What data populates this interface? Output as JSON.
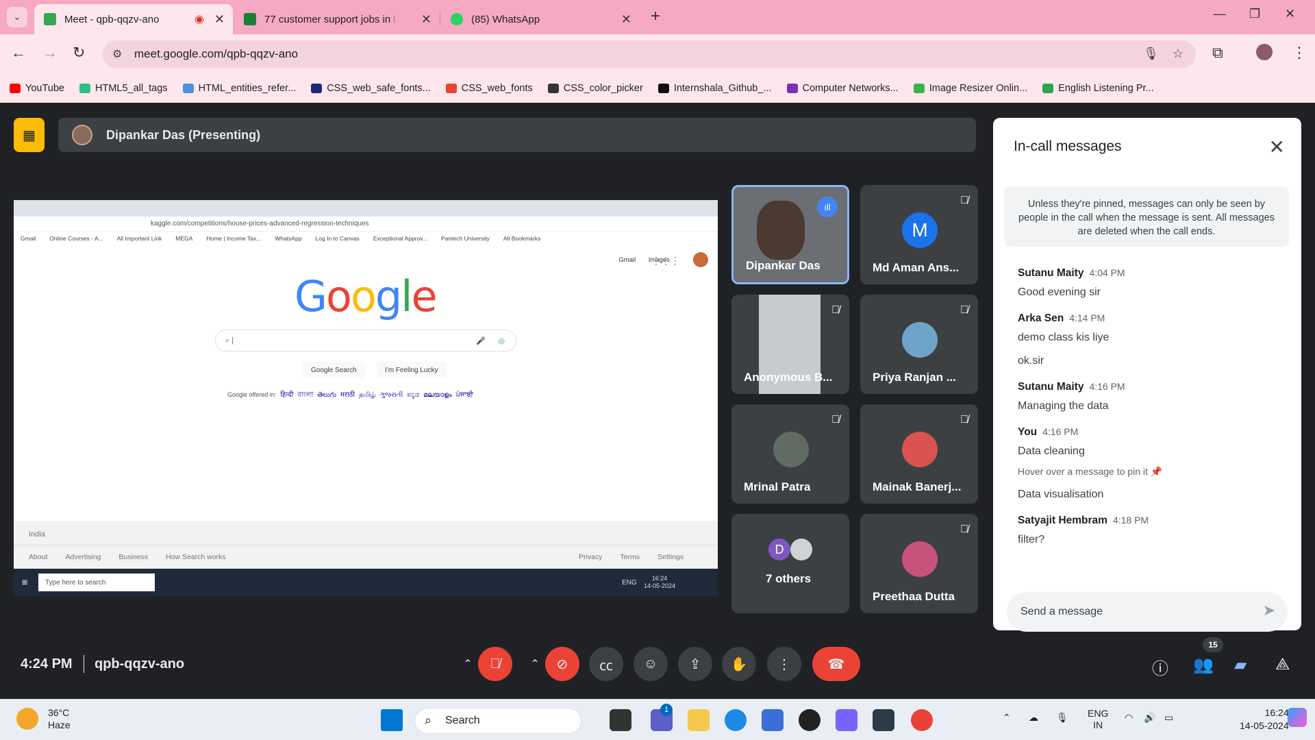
{
  "browser": {
    "tabs": [
      {
        "title": "Meet - qpb-qqzv-ano",
        "color": "#34a853"
      },
      {
        "title": "77 customer support jobs in Re",
        "color": "#1a7f37"
      },
      {
        "title": "(85) WhatsApp",
        "color": "#25d366"
      }
    ],
    "url": "meet.google.com/qpb-qqzv-ano",
    "bookmarks": [
      {
        "label": "YouTube",
        "color": "#ff0000"
      },
      {
        "label": "HTML5_all_tags",
        "color": "#2bbf8a"
      },
      {
        "label": "HTML_entities_refer...",
        "color": "#4a90e2"
      },
      {
        "label": "CSS_web_safe_fonts...",
        "color": "#1d2a7a"
      },
      {
        "label": "CSS_web_fonts",
        "color": "#e94335"
      },
      {
        "label": "CSS_color_picker",
        "color": "#333333"
      },
      {
        "label": "Internshala_Github_...",
        "color": "#111111"
      },
      {
        "label": "Computer Networks...",
        "color": "#7b2fb5"
      },
      {
        "label": "Image Resizer Onlin...",
        "color": "#3bb54a"
      },
      {
        "label": "English Listening Pr...",
        "color": "#2ea44f"
      }
    ]
  },
  "meet": {
    "presenter": "Dipankar Das (Presenting)",
    "shared_screen": {
      "url": "kaggle.com/competitions/house-prices-advanced-regression-techniques",
      "bookmarks": [
        "Gmail",
        "Online Courses - A...",
        "All Important Link",
        "MEGA",
        "Home | Income Tax...",
        "WhatsApp",
        "Log In to Canvas",
        "Exceptional Approv...",
        "Pantech University",
        "All Bookmarks"
      ],
      "top_links": [
        "Gmail",
        "Images"
      ],
      "logo": "Google",
      "search_btn": "Google Search",
      "lucky_btn": "I'm Feeling Lucky",
      "offered_label": "Google offered in:",
      "languages": [
        "हिन्दी",
        "বাংলা",
        "తెలుగు",
        "मराठी",
        "தமிழ்",
        "ગુજરાતી",
        "ಕನ್ನಡ",
        "മലയാളം",
        "ਪੰਜਾਬੀ"
      ],
      "country": "India",
      "footer_left": [
        "About",
        "Advertising",
        "Business",
        "How Search works"
      ],
      "footer_right": [
        "Privacy",
        "Terms",
        "Settings"
      ],
      "taskbar_search": "Type here to search",
      "taskbar_time": "16:24",
      "taskbar_date": "14-05-2024",
      "taskbar_lang": "ENG"
    },
    "participants": [
      {
        "name": "Dipankar Das"
      },
      {
        "name": "Md Aman Ans...",
        "initial": "M",
        "color": "#1a73e8"
      },
      {
        "name": "Anonymous B..."
      },
      {
        "name": "Priya Ranjan ..."
      },
      {
        "name": "Mrinal Patra"
      },
      {
        "name": "Mainak Banerj..."
      },
      {
        "name": "7 others",
        "initial": "D",
        "color": "#7e57c2"
      },
      {
        "name": "Preethaa Dutta"
      }
    ],
    "time": "4:24 PM",
    "code": "qpb-qqzv-ano",
    "participant_count": "15"
  },
  "chat": {
    "title": "In-call messages",
    "notice": "Unless they're pinned, messages can only be seen by people in the call when the message is sent. All messages are deleted when the call ends.",
    "messages": [
      {
        "sender": "Sutanu Maity",
        "time": "4:04 PM",
        "lines": [
          "Good evening sir"
        ]
      },
      {
        "sender": "Arka Sen",
        "time": "4:14 PM",
        "lines": [
          "demo class kis liye",
          "ok.sir"
        ]
      },
      {
        "sender": "Sutanu Maity",
        "time": "4:16 PM",
        "lines": [
          "Managing the data"
        ]
      },
      {
        "sender": "You",
        "time": "4:16 PM",
        "lines": [
          "Data cleaning",
          "Data visualisation"
        ],
        "hover": "Hover over a message to pin it"
      },
      {
        "sender": "Satyajit Hembram",
        "time": "4:18 PM",
        "lines": [
          "filter?"
        ]
      }
    ],
    "placeholder": "Send a message"
  },
  "taskbar": {
    "temp": "36°C",
    "weather": "Haze",
    "search": "Search",
    "lang1": "ENG",
    "lang2": "IN",
    "time": "16:24",
    "date": "14-05-2024",
    "teams_badge": "1"
  }
}
